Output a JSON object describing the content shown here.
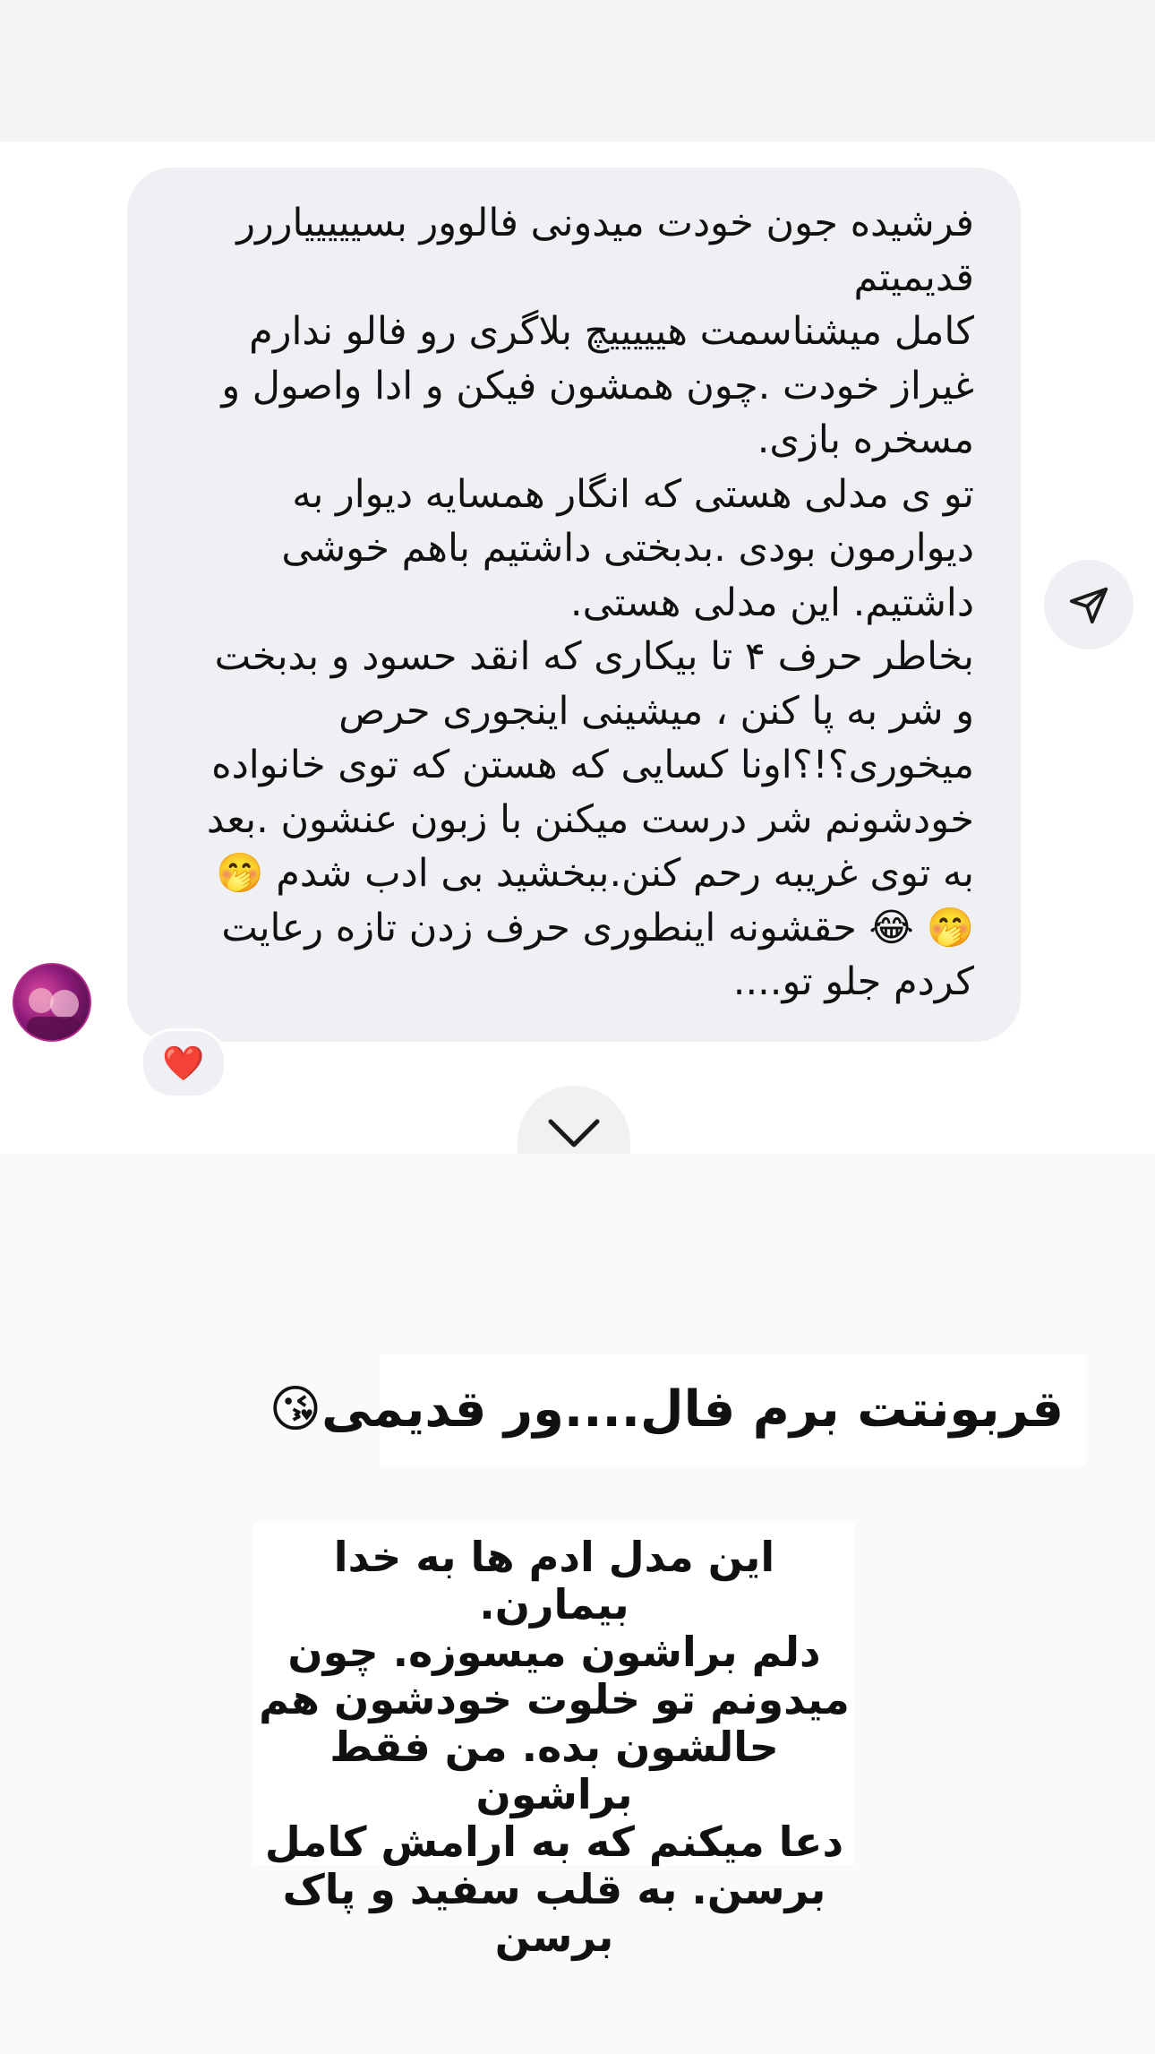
{
  "message": {
    "paragraphs": [
      "فرشیده جون خودت میدونی فالوور بسیییییاررر\nقدیمیتم",
      "کامل میشناسمت هیییییچ بلاگری رو فالو ندارم\nغیراز خودت .چون همشون فیکن و ادا واصول و\nمسخره بازی.",
      "تو ی مدلی هستی که انگار همسایه دیوار به\nدیوارمون بودی .بدبختی داشتیم باهم خوشی\nداشتیم. این مدلی هستی.",
      "بخاطر حرف ۴ تا بیکاری که انقد حسود و بدبخت\nو شر به پا کنن ، میشینی اینجوری حرص\nمیخوری؟!؟اونا کسایی که هستن که توی خانواده\nخودشونم شر درست میکنن با زبون عنشون .بعد\nبه توی غریبه رحم کنن.ببخشید بی ادب شدم 🤭\n🤭 😂 حقشونه اینطوری حرف زدن تازه رعایت\nکردم جلو تو...."
    ],
    "reaction": "❤️"
  },
  "icons": {
    "send": "paper-plane-icon",
    "scroll": "chevron-down-icon",
    "avatar": "user-avatar"
  },
  "captions": {
    "line1": "قربونتت برم فال....ور قدیمی😘",
    "block": "این مدل ادم ها به خدا بیمارن.\nدلم براشون میسوزه. چون\nمیدونم تو خلوت خودشون هم\nحالشون بده. من فقط براشون\nدعا میکنم که به ارامش کامل\nبرسن. به قلب سفید و پاک برسن"
  },
  "colors": {
    "bubble": "#eff0f3",
    "text": "#111111",
    "heart": "#e0243a",
    "avatar_accent": "#b52c8c"
  }
}
